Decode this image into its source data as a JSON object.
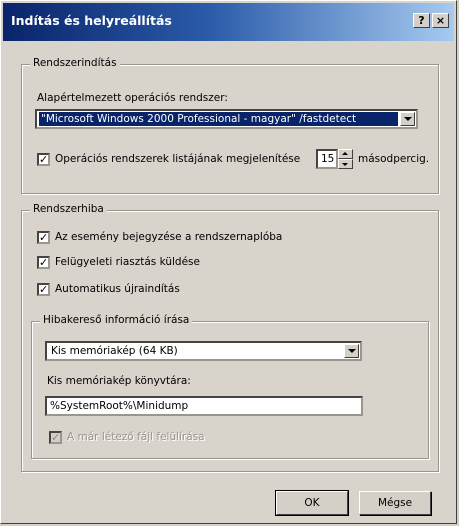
{
  "window": {
    "title": "Indítás és helyreállítás",
    "help_btn": "?",
    "close_btn": "×"
  },
  "startup": {
    "legend": "Rendszerindítás",
    "default_os_label": "Alapértelmezett operációs rendszer:",
    "default_os_value": "\"Microsoft Windows 2000 Professional - magyar\" /fastdetect",
    "show_list_checked": true,
    "show_list_label": "Operációs rendszerek listájának megjelenítése",
    "show_list_seconds": "15",
    "seconds_unit": "másodpercig."
  },
  "failure": {
    "legend": "Rendszerhiba",
    "options": [
      {
        "label": "Az esemény bejegyzése a rendszernaplóba",
        "checked": true
      },
      {
        "label": "Felügyeleti riasztás küldése",
        "checked": true
      },
      {
        "label": "Automatikus újraindítás",
        "checked": true
      }
    ],
    "debug": {
      "legend": "Hibakereső információ írása",
      "dump_type_value": "Kis memóriakép (64 KB)",
      "dump_dir_label": "Kis memóriakép könyvtára:",
      "dump_dir_value": "%SystemRoot%\\Minidump",
      "overwrite_label": "A már létező fájl felülírása",
      "overwrite_checked": true,
      "overwrite_disabled": true
    }
  },
  "buttons": {
    "ok": "OK",
    "cancel": "Mégse"
  },
  "check_glyph": "✓"
}
